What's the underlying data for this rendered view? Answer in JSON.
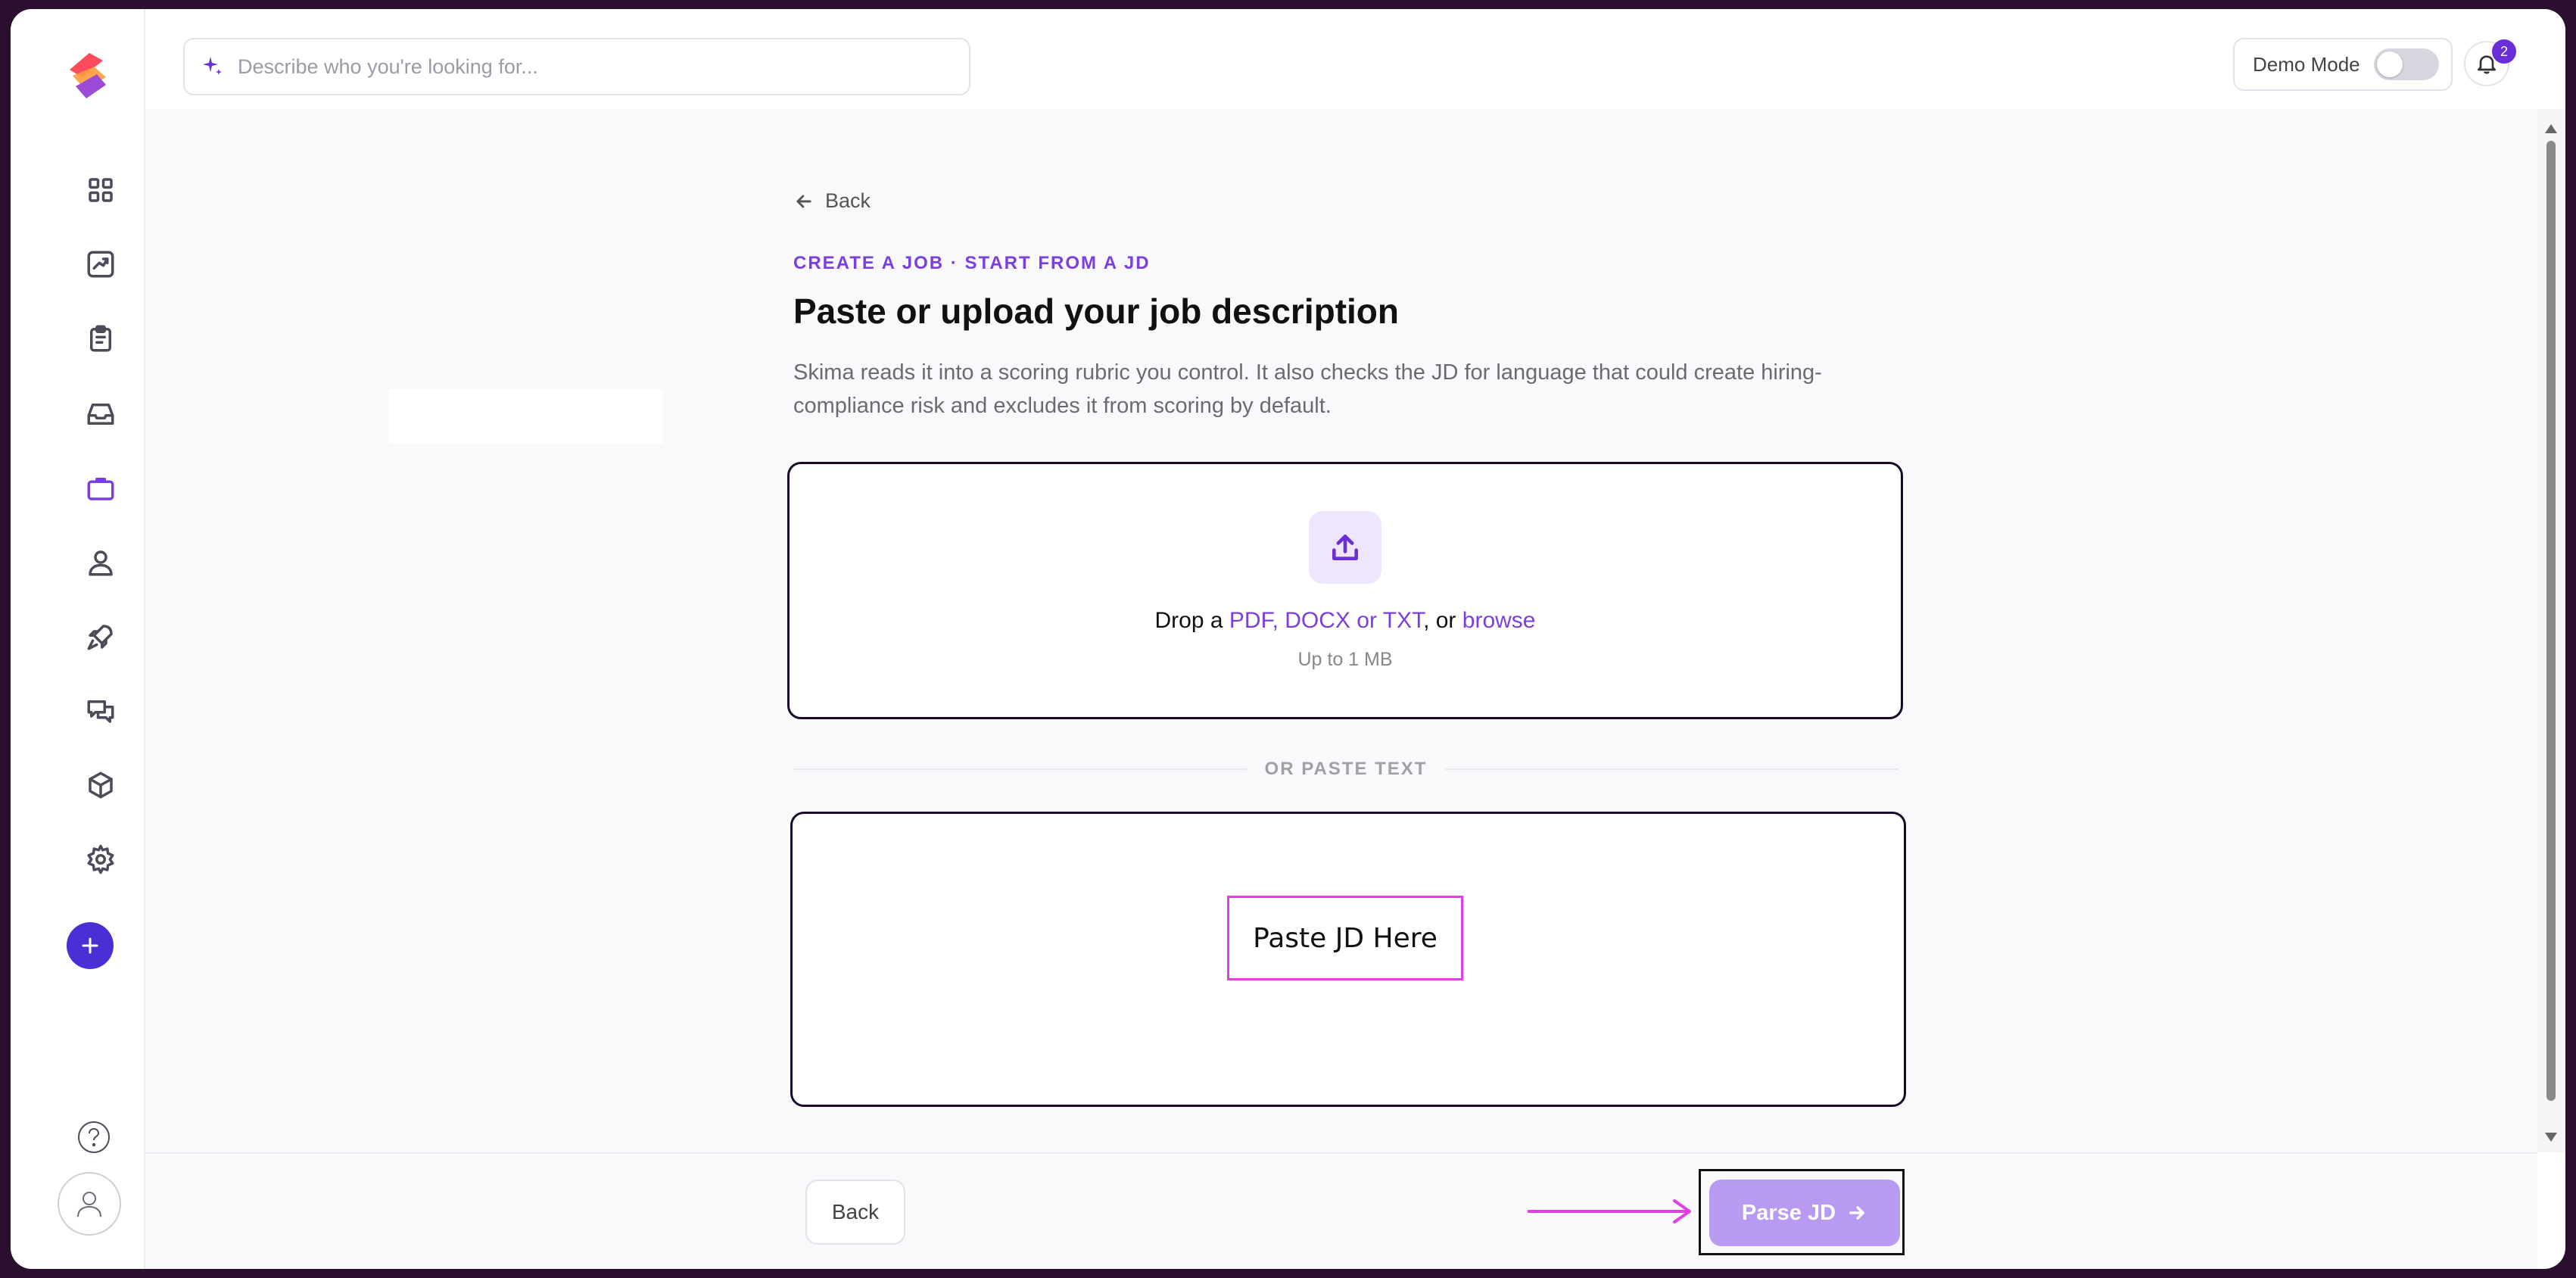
{
  "topbar": {
    "search_placeholder": "Describe who you're looking for...",
    "demo_mode_label": "Demo Mode",
    "notification_count": "2"
  },
  "page": {
    "back_link": "Back",
    "eyebrow": "CREATE A JOB · START FROM A JD",
    "title": "Paste or upload your job description",
    "description": "Skima reads it into a scoring rubric you control. It also checks the JD for language that could create hiring-compliance risk and excludes it from scoring by default."
  },
  "dropzone": {
    "prefix": "Drop a ",
    "formats": "PDF, DOCX or TXT",
    "middle": ", or ",
    "browse": "browse",
    "size_limit": "Up to 1 MB"
  },
  "divider_label": "OR PASTE TEXT",
  "paste_area": {
    "label": "Paste JD Here"
  },
  "footer": {
    "back_button": "Back",
    "parse_button": "Parse JD"
  },
  "colors": {
    "accent": "#7b3fe0",
    "primary_button": "#4b2fd6",
    "parse_button_disabled": "#b89af2",
    "annotation": "#e040e0"
  },
  "icons": [
    "logo",
    "dashboard-icon",
    "analytics-icon",
    "clipboard-icon",
    "inbox-icon",
    "briefcase-icon",
    "person-icon",
    "rocket-icon",
    "chat-icon",
    "cube-icon",
    "gear-icon",
    "plus-icon",
    "help-icon",
    "avatar-icon",
    "sparkle-icon",
    "bell-icon",
    "upload-icon",
    "arrow-left-icon",
    "arrow-right-icon"
  ]
}
